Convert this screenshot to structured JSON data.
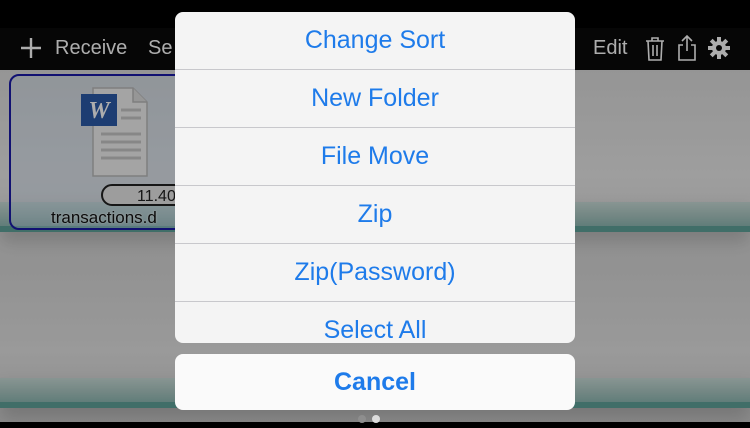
{
  "toolbar": {
    "add_icon": "plus-icon",
    "receive_label": "Receive",
    "send_label": "Se",
    "edit_label": "Edit",
    "trash_icon": "trash-icon",
    "share_icon": "share-icon",
    "settings_icon": "gear-icon"
  },
  "file": {
    "icon": "word-doc-icon",
    "size": "11.40",
    "name": "transactions.d"
  },
  "action_sheet": {
    "items": [
      "Change Sort",
      "New Folder",
      "File Move",
      "Zip",
      "Zip(Password)",
      "Select All"
    ],
    "cancel_label": "Cancel"
  },
  "colors": {
    "accent": "#1e7bea",
    "selection_border": "#1a1aa8",
    "toolbar_bg": "#0a0a0a",
    "word_blue": "#2b5aa8"
  }
}
